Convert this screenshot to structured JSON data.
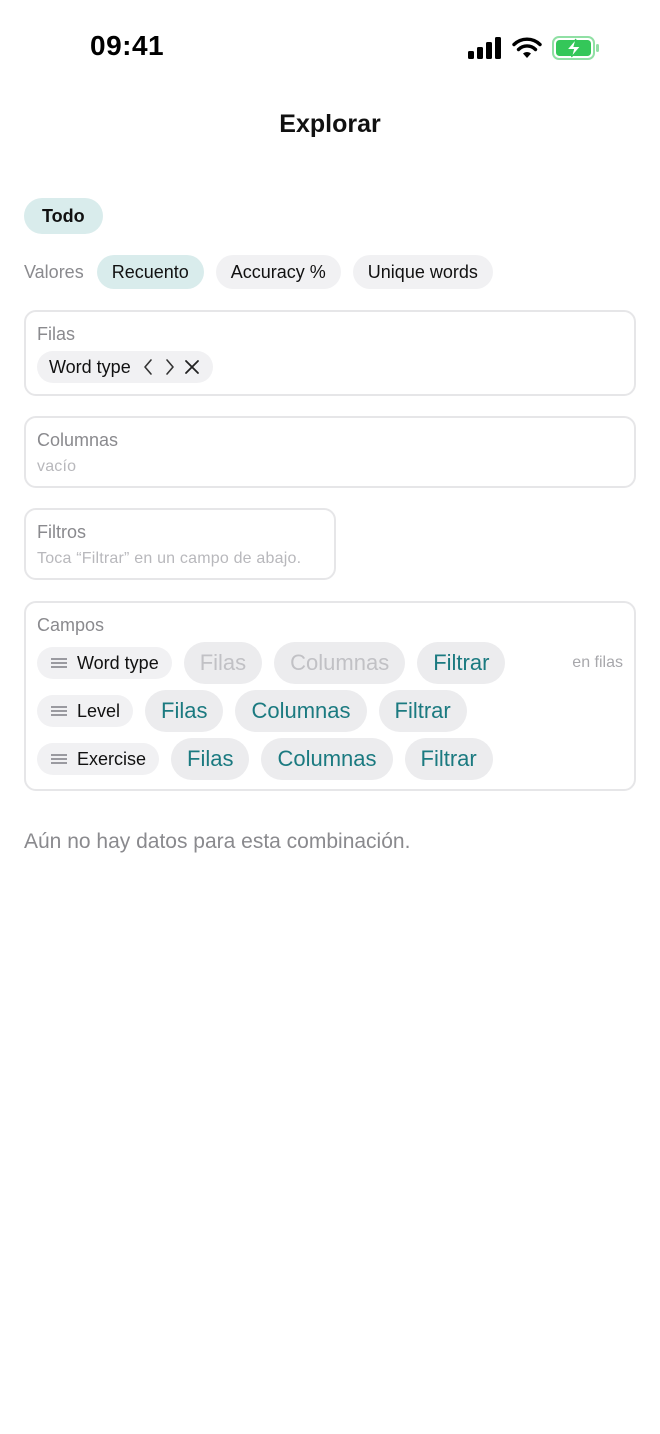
{
  "status_bar": {
    "time": "09:41"
  },
  "nav": {
    "title": "Explorar"
  },
  "scope": {
    "todo": "Todo"
  },
  "values": {
    "label": "Valores",
    "options": [
      {
        "label": "Recuento",
        "selected": true
      },
      {
        "label": "Accuracy %",
        "selected": false
      },
      {
        "label": "Unique words",
        "selected": false
      }
    ]
  },
  "rows_zone": {
    "title": "Filas",
    "chip_label": "Word type"
  },
  "columns_zone": {
    "title": "Columnas",
    "empty": "vacío"
  },
  "filters_zone": {
    "title": "Filtros",
    "empty": "Toca “Filtrar” en un campo de abajo."
  },
  "fields": {
    "title": "Campos",
    "items": [
      {
        "name": "Word type",
        "filas": "Filas",
        "columnas": "Columnas",
        "filtrar": "Filtrar",
        "status": "en filas"
      },
      {
        "name": "Level",
        "filas": "Filas",
        "columnas": "Columnas",
        "filtrar": "Filtrar"
      },
      {
        "name": "Exercise",
        "filas": "Filas",
        "columnas": "Columnas",
        "filtrar": "Filtrar"
      }
    ]
  },
  "empty_message": "Aún no hay datos para esta combinación.",
  "colors": {
    "accent": "#1b7a80",
    "selected_chip": "#d9ecec",
    "battery_green": "#34c759"
  },
  "icons": [
    "signal-icon",
    "wifi-icon",
    "battery-charging-icon",
    "chevron-left-icon",
    "chevron-right-icon",
    "close-icon",
    "drag-handle-icon"
  ]
}
